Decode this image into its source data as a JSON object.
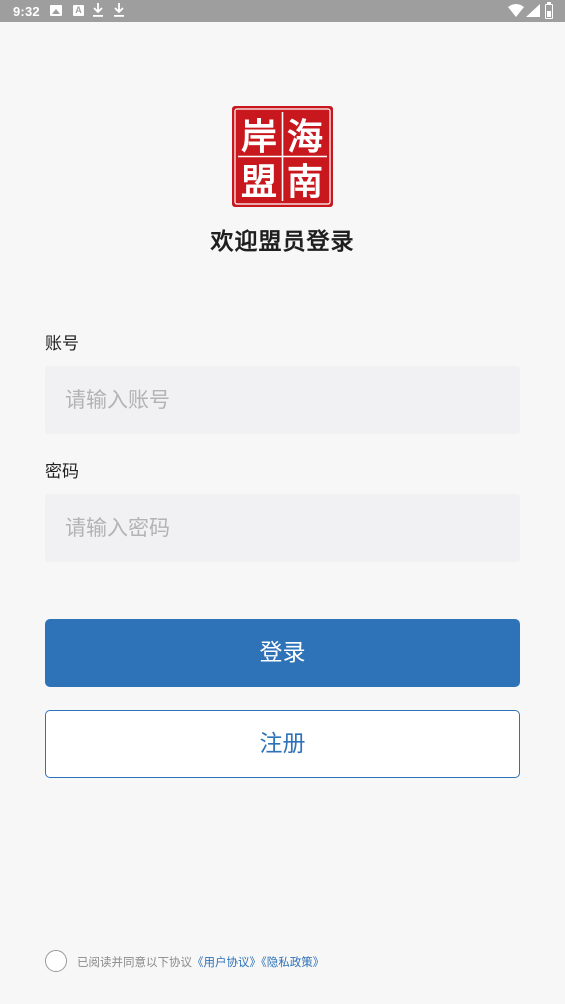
{
  "status_bar": {
    "time": "9:32",
    "icons": [
      "photo-icon",
      "a-icon",
      "download-icon",
      "download-icon",
      "wifi-icon",
      "signal-icon",
      "battery-icon"
    ]
  },
  "logo": {
    "text_chars": [
      "海",
      "岸",
      "盟",
      "南"
    ],
    "color": "#c8181e"
  },
  "welcome": "欢迎盟员登录",
  "account": {
    "label": "账号",
    "placeholder": "请输入账号",
    "value": ""
  },
  "password": {
    "label": "密码",
    "placeholder": "请输入密码",
    "value": ""
  },
  "buttons": {
    "login": "登录",
    "register": "注册"
  },
  "agreement": {
    "checked": false,
    "prefix": "已阅读并同意以下协议",
    "user_agreement": "《用户协议》",
    "privacy_policy": "《隐私政策》"
  },
  "colors": {
    "primary": "#2e72b8",
    "background": "#f7f7f7",
    "input_bg": "#f1f1f3",
    "status_bar": "#9e9e9e"
  }
}
